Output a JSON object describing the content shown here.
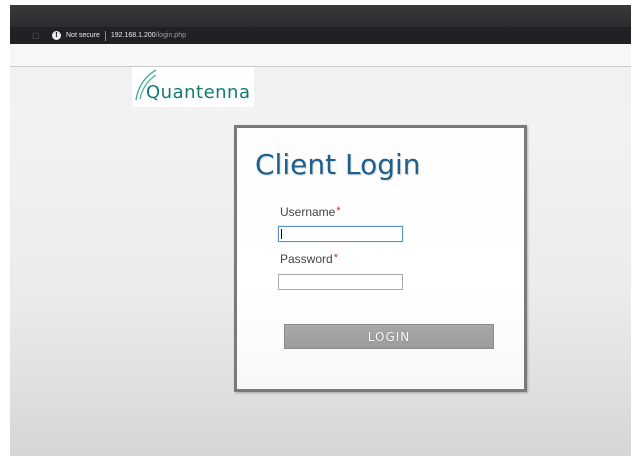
{
  "browser": {
    "security_icon": "info-icon",
    "security_label": "Not secure",
    "url_host": "192.168.1.200",
    "url_path": "/login.php"
  },
  "header": {
    "logo_text": "Quantenna",
    "brand_color": "#137a71"
  },
  "login": {
    "title": "Client Login",
    "title_color": "#1f5f8c",
    "username_label": "Username",
    "password_label": "Password",
    "required_marker": "*",
    "username_value": "",
    "password_value": "",
    "button_label": "LOGIN"
  }
}
